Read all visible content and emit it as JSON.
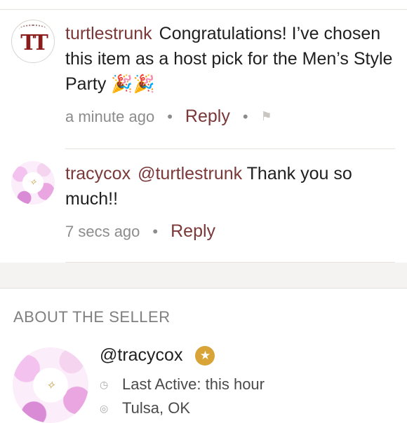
{
  "comments": [
    {
      "username": "turtlestrunk",
      "avatar_text": "TT",
      "text": "Congratulations! I’ve chosen this item as a host pick for the Men’s Style Party",
      "emoji": "🎉🎉",
      "time": "a minute ago",
      "reply_label": "Reply",
      "flag_icon": "⚑"
    },
    {
      "username": "tracycox",
      "mention": "@turtlestrunk",
      "text": "Thank you so much!!",
      "time": "7 secs ago",
      "reply_label": "Reply"
    }
  ],
  "about": {
    "heading": "ABOUT THE SELLER",
    "handle": "@tracycox",
    "badge_icon": "★",
    "last_active": "Last Active: this hour",
    "location": "Tulsa, OK"
  },
  "colors": {
    "accent": "#7a3838",
    "muted": "#8c8c8c",
    "badge": "#d9a437"
  }
}
